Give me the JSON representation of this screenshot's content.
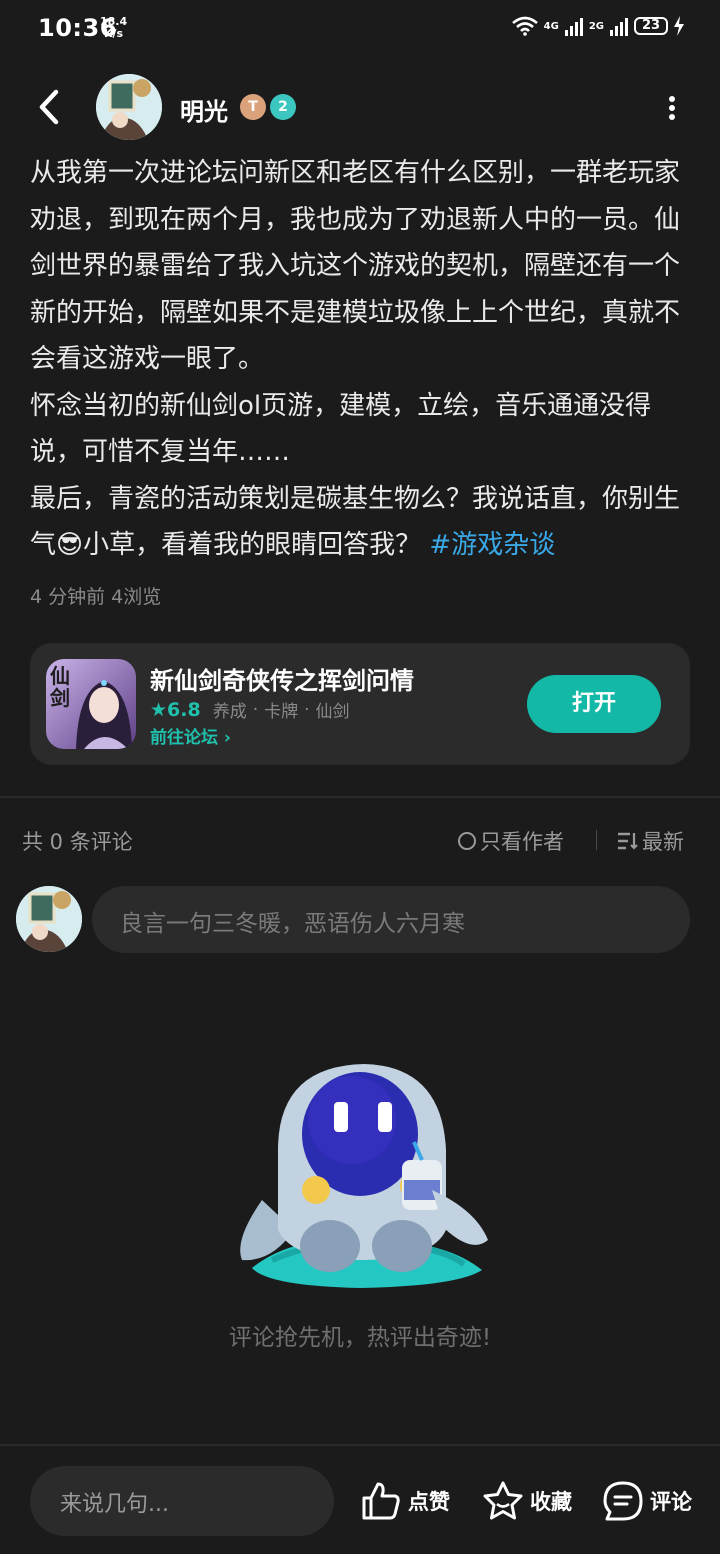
{
  "status_bar": {
    "time": "10:36",
    "speed_value": "18.4",
    "speed_unit": "K/s",
    "net1": "4G",
    "net2": "2G",
    "battery": "23"
  },
  "header": {
    "author_name": "明光",
    "badge_t": "T",
    "badge_level": "2"
  },
  "post": {
    "paragraphs": [
      "从我第一次进论坛问新区和老区有什么区别，一群老玩家劝退，到现在两个月，我也成为了劝退新人中的一员。仙剑世界的暴雷给了我入坑这个游戏的契机，隔壁还有一个新的开始，隔壁如果不是建模垃圾像上上个世纪，真就不会看这游戏一眼了。",
      "怀念当初的新仙剑ol页游，建模，立绘，音乐通通没得说，可惜不复当年……",
      "最后，青瓷的活动策划是碳基生物么？我说话直，你别生气"
    ],
    "emoji": "😎",
    "tail_text": "小草，看着我的眼睛回答我？",
    "topic": "#游戏杂谈",
    "meta": "4 分钟前  4浏览"
  },
  "game_card": {
    "icon_text": "仙剑",
    "title": "新仙剑奇侠传之挥剑问情",
    "rating": "★6.8",
    "tags": [
      "养成",
      "卡牌",
      "仙剑"
    ],
    "tag_separator": "·",
    "forum_link": "前往论坛 ›",
    "open_label": "打开"
  },
  "comments": {
    "count_label": "共 0 条评论",
    "author_only_label": "只看作者",
    "sort_label": "最新",
    "input_placeholder": "良言一句三冬暖，恶语伤人六月寒",
    "empty_text": "评论抢先机，热评出奇迹!"
  },
  "bottom_bar": {
    "input_placeholder": "来说几句...",
    "like_label": "点赞",
    "favorite_label": "收藏",
    "comment_label": "评论"
  },
  "colors": {
    "background": "#1b1b1b",
    "card": "#2b2b2b",
    "accent": "#14b8a6",
    "topic": "#3aa8e6",
    "muted": "#8a8a8a"
  }
}
